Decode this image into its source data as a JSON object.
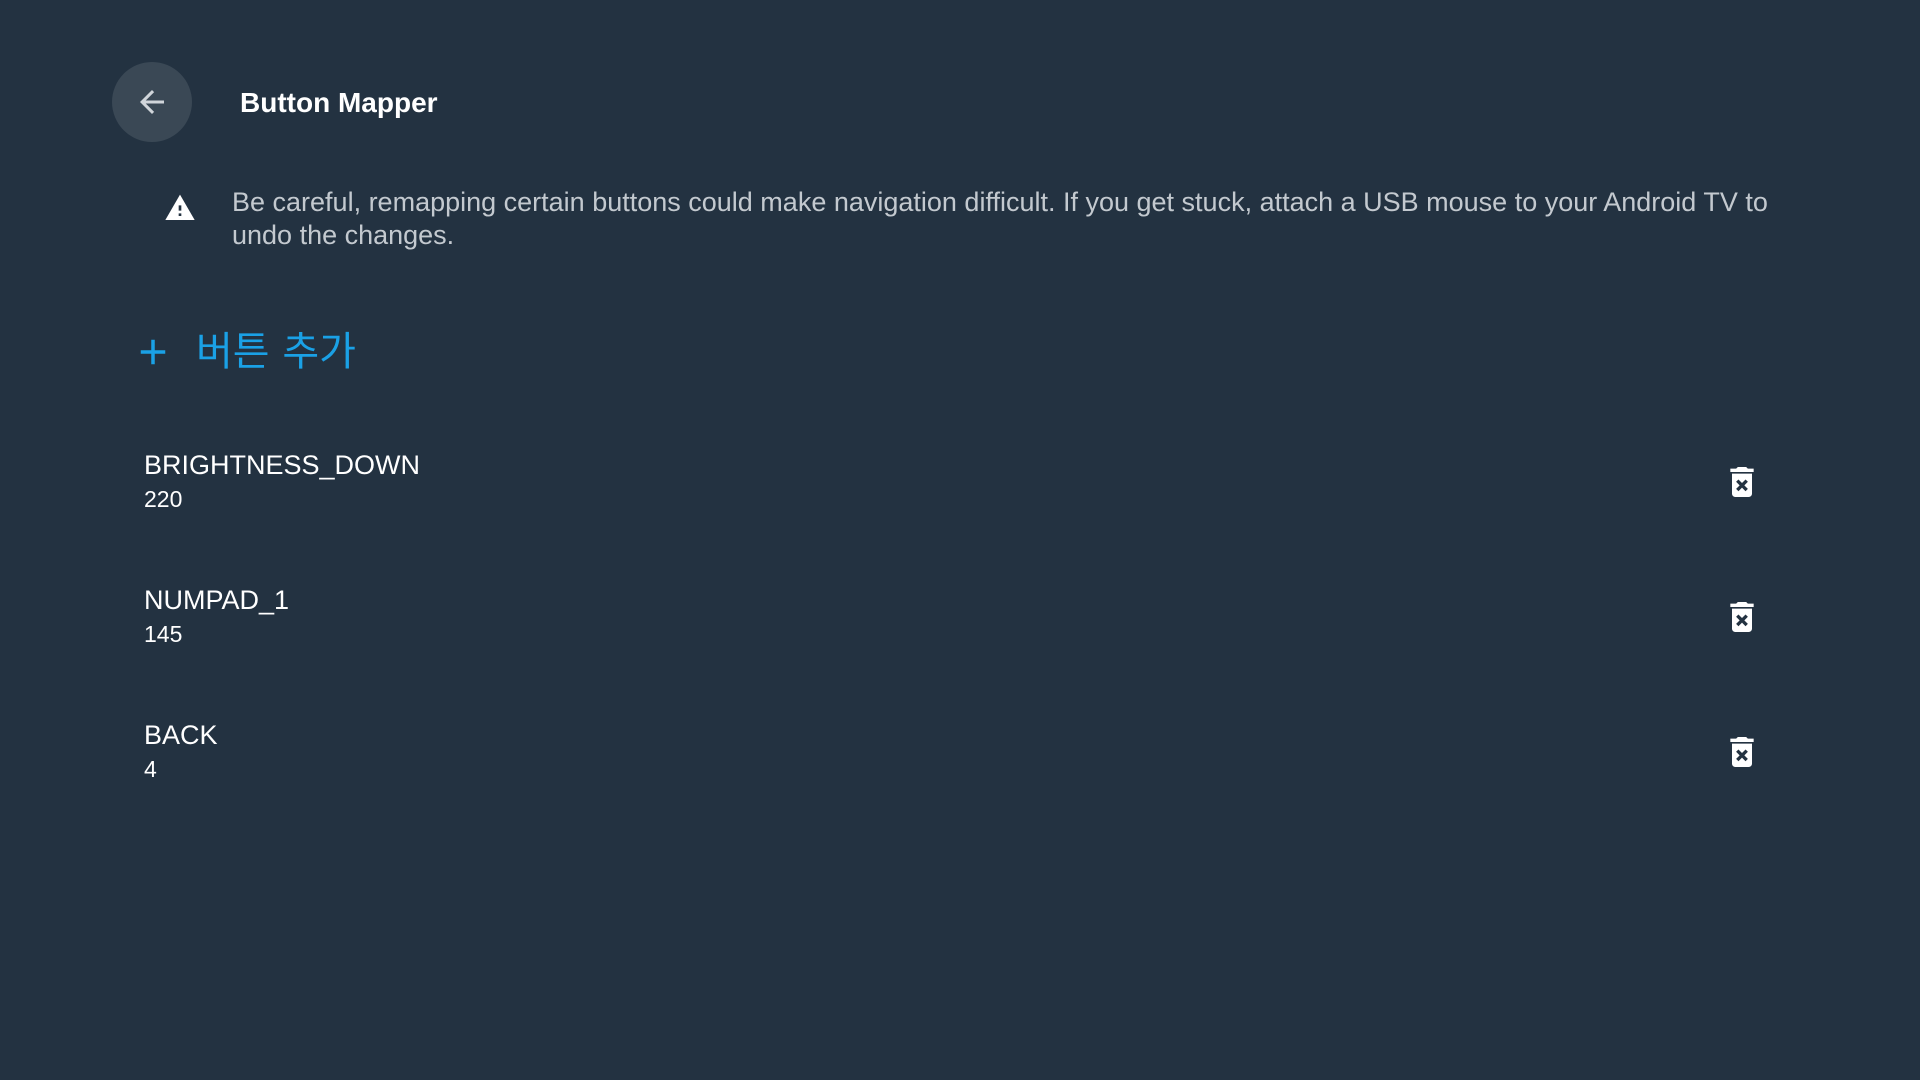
{
  "header": {
    "title": "Button Mapper",
    "back_icon": "arrow-left-icon"
  },
  "warning": {
    "icon": "warning-triangle-icon",
    "text": "Be careful, remapping certain buttons could make navigation difficult. If you get stuck, attach a USB mouse to your Android TV to undo the changes."
  },
  "add_button": {
    "icon": "plus-icon",
    "label": "버튼 추가"
  },
  "mappings": [
    {
      "name": "BRIGHTNESS_DOWN",
      "code": "220",
      "delete_icon": "delete-forever-icon"
    },
    {
      "name": "NUMPAD_1",
      "code": "145",
      "delete_icon": "delete-forever-icon"
    },
    {
      "name": "BACK",
      "code": "4",
      "delete_icon": "delete-forever-icon"
    }
  ],
  "colors": {
    "background": "#233241",
    "accent": "#1aa1e6",
    "back_button_bg": "#3a4855",
    "secondary_text": "#c3c9cf"
  }
}
